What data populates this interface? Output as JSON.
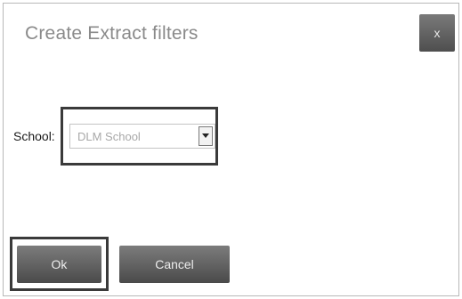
{
  "dialog": {
    "title": "Create Extract filters",
    "close_label": "x"
  },
  "filters": {
    "school_label": "School:",
    "school_selected": "DLM School"
  },
  "buttons": {
    "ok_label": "Ok",
    "cancel_label": "Cancel"
  },
  "icons": {
    "dropdown": "chevron-down-icon"
  }
}
